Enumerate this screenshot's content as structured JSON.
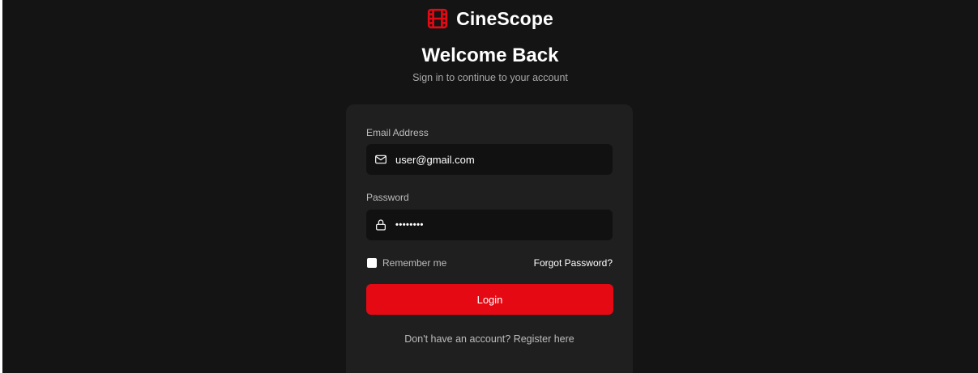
{
  "brand": {
    "name": "CineScope",
    "icon": "film-icon",
    "accent_color": "#e50914"
  },
  "heading": {
    "title": "Welcome Back",
    "subtitle": "Sign in to continue to your account"
  },
  "form": {
    "email": {
      "label": "Email Address",
      "value": "user@gmail.com",
      "icon": "mail-icon"
    },
    "password": {
      "label": "Password",
      "masked_value": "••••••••",
      "icon": "lock-icon"
    },
    "remember_label": "Remember me",
    "forgot_label": "Forgot Password?",
    "submit_label": "Login",
    "register_text": "Don't have an account? Register here"
  }
}
